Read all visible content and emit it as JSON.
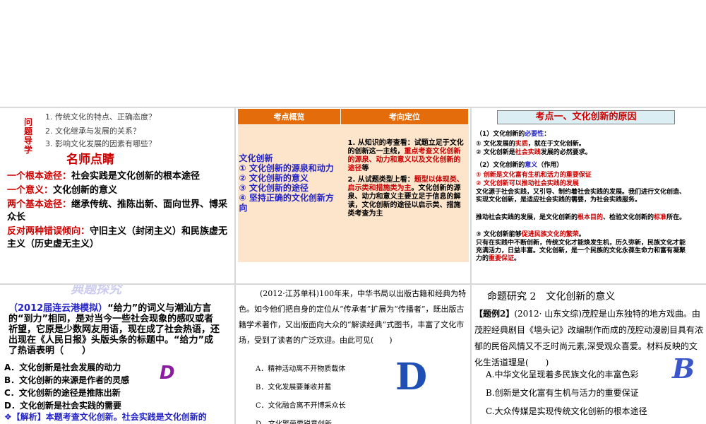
{
  "panel1": {
    "side_label": "问题导学",
    "questions": [
      "1. 传统文化的特点、正确态度？",
      "2. 文化继承与发展的关系？",
      "3. 影响文化发展的因素有哪些？"
    ],
    "title": "名师点睛",
    "lines": [
      {
        "key": "一个根本途径：",
        "text": "社会实践是文化创新的根本途径"
      },
      {
        "key": "一个意义：",
        "text": "文化创新的意义"
      },
      {
        "key": "两个基本途径：",
        "text": "继承传统、推陈出新、面向世界、博采众长"
      },
      {
        "key": "反对两种错误倾向：",
        "text": "守旧主义（封闭主义）和民族虚无主义（历史虚无主义）"
      }
    ]
  },
  "panel2": {
    "header_left": "考点概览",
    "header_right": "考向定位",
    "left_items": [
      "文化创新",
      "① 文化创新的源泉和动力",
      "② 文化创新的意义",
      "③ 文化创新的途径",
      "④ 坚持正确的文化创新方向"
    ],
    "right_p1_a": "1. 从知识的考查看：试题立足于文化的创新这一主线，",
    "right_p1_b": "重点考查文化创新的源泉、动力和意义以及文化创新的途径",
    "right_p1_c": "等",
    "right_p2_a": "2. 从试题类型上看：",
    "right_p2_b": "题型以体现类、启示类和措施类为主",
    "right_p2_c": "。文化创新的源泉、动力和意义主要立足于信息的解读，文化创新的途径以启示类、措施类考查为主"
  },
  "panel3": {
    "title": "考点一、文化创新的原因",
    "s1_a": "（1）文化创新的",
    "s1_b": "必要性",
    "s1_c": "：",
    "s1_l1_a": "① 文化发展的",
    "s1_l1_b": "实质",
    "s1_l1_c": "，就在于文化创新。",
    "s1_l2_a": "② 文化创新是",
    "s1_l2_b": "社会实践",
    "s1_l2_c": "发展的必然要求。",
    "s2_a": "（2）文化创新的",
    "s2_b": "意义",
    "s2_c": "（作用）",
    "s2_l1": "① 创新是文化富有生机和活力的重要保证",
    "s2_l2": "② 文化创新可以推动社会实践的发展",
    "s2_l3": "文化源于社会实践，又引导、制约着社会实践的发展。我们进行文化创造、实现文化创新，是适应社会实践的需要，为社会实践服务。",
    "s2_l4_a": "推动社会实践的发展，是文化创新的",
    "s2_l4_b": "根本目的",
    "s2_l4_c": "、检验文化创新的",
    "s2_l4_d": "标准",
    "s2_l4_e": "所在。",
    "s2_l5_a": "③ 文化创新能够",
    "s2_l5_b": "促进民族文化的繁荣",
    "s2_l5_c": "。",
    "s2_l6_a": "只有在实践中不断创新，传统文化才能焕发生机，历久弥新，民族文化才能充满活力，日益丰富。文化创新，是一个民族的文化永葆生命力和富有凝聚力的",
    "s2_l6_b": "重要保证",
    "s2_l6_c": "。"
  },
  "panel4": {
    "banner": "典题探究",
    "source": "（2012届连云港模拟）",
    "stem": "“给力”的词义与潮汕方言的“到力”相同，是对当今一些社会现象的感叹或者祈望，它原是少数网友用语，现在成了社会热语，还出现在《人民日报》头版头条的标题中。“给力”成了热语表明（　　）",
    "options": [
      "A．文化创新是社会发展的动力",
      "B．文化创新的来源是作者的灵感",
      "C．文化创新的途径是推陈出新",
      "D．文化创新是社会实践的需要"
    ],
    "answer": "D",
    "analysis": "❖【解析】本题考查文化创新。社会实践是文化创新的"
  },
  "panel5": {
    "stem_first": "(2012·江苏单科)100年来，中华书局以出版古籍和经典为特色。如今他们把自身的定位从“传承者”扩展为“传播者”，既出版古籍学术著作，又出版面向大众的“解读经典”式图书，丰富了文化市场，受到了读者的广泛欢迎。由此可见(　　)",
    "options": [
      "A．精神活动离不开物质载体",
      "B．文化发展要兼收并蓄",
      "C．文化融合离不开博采众长",
      "D．文化繁荣要锐意创新"
    ],
    "answer": "D"
  },
  "panel6": {
    "heading": "命题研究 2　文化创新的意义",
    "label": "【题例2】",
    "stem": "(2012· 山东文综)茂腔是山东独特的地方戏曲。由茂腔经典剧目《墙头记》改编制作而成的茂腔动漫剧目具有浓郁的民俗风情又不乏时尚元素,深受观众喜爱。材料反映的文化生活道理是(　　)",
    "options": [
      "A.中华文化呈现着多民族文化的丰富色彩",
      "B.创新是文化富有生机与活力的重要保证",
      "C.大众传媒是实现传统文化创新的根本途径"
    ],
    "answer": "B"
  }
}
